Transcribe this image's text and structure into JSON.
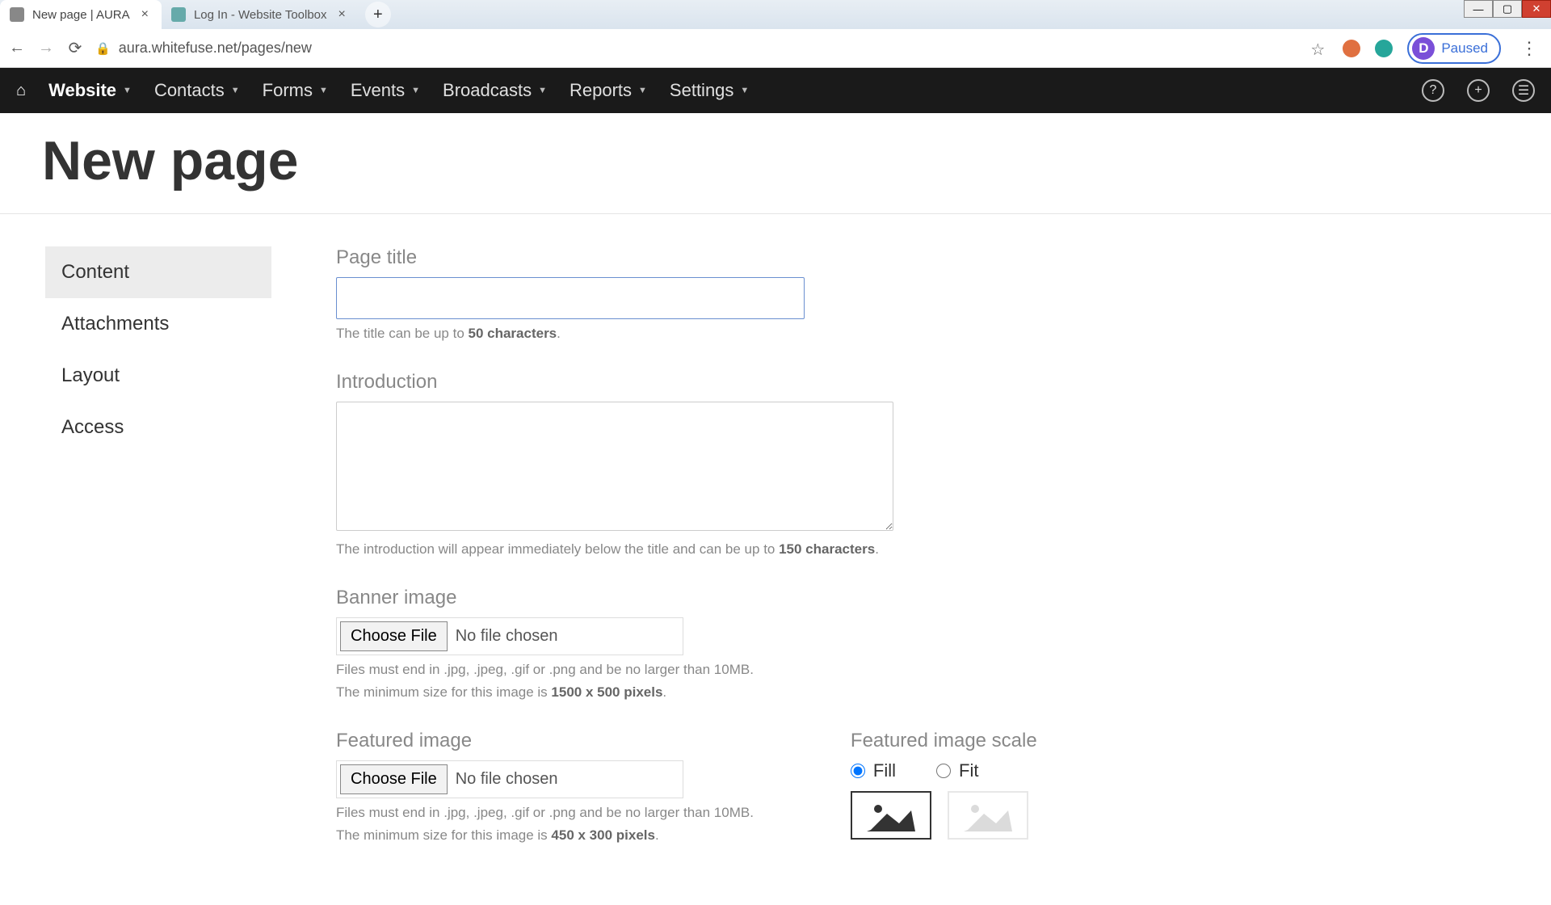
{
  "browser": {
    "tabs": [
      {
        "title": "New page | AURA",
        "active": true
      },
      {
        "title": "Log In - Website Toolbox",
        "active": false
      }
    ],
    "url": "aura.whitefuse.net/pages/new",
    "paused_label": "Paused",
    "paused_initial": "D"
  },
  "nav": {
    "items": [
      "Website",
      "Contacts",
      "Forms",
      "Events",
      "Broadcasts",
      "Reports",
      "Settings"
    ]
  },
  "page": {
    "heading": "New page"
  },
  "sidebar": {
    "tabs": [
      "Content",
      "Attachments",
      "Layout",
      "Access"
    ]
  },
  "form": {
    "page_title": {
      "label": "Page title",
      "value": "",
      "hint_prefix": "The title can be up to ",
      "hint_bold": "50 characters",
      "hint_suffix": "."
    },
    "introduction": {
      "label": "Introduction",
      "value": "",
      "hint_prefix": "The introduction will appear immediately below the title and can be up to ",
      "hint_bold": "150 characters",
      "hint_suffix": "."
    },
    "banner": {
      "label": "Banner image",
      "choose_label": "Choose File",
      "status": "No file chosen",
      "hint1": "Files must end in .jpg, .jpeg, .gif or .png and be no larger than 10MB.",
      "hint2a": "The minimum size for this image is ",
      "hint2b": "1500 x 500 pixels",
      "hint2c": "."
    },
    "featured": {
      "label": "Featured image",
      "choose_label": "Choose File",
      "status": "No file chosen",
      "hint1": "Files must end in .jpg, .jpeg, .gif or .png and be no larger than 10MB.",
      "hint2a": "The minimum size for this image is ",
      "hint2b": "450 x 300 pixels",
      "hint2c": "."
    },
    "scale": {
      "label": "Featured image scale",
      "fill": "Fill",
      "fit": "Fit"
    }
  }
}
